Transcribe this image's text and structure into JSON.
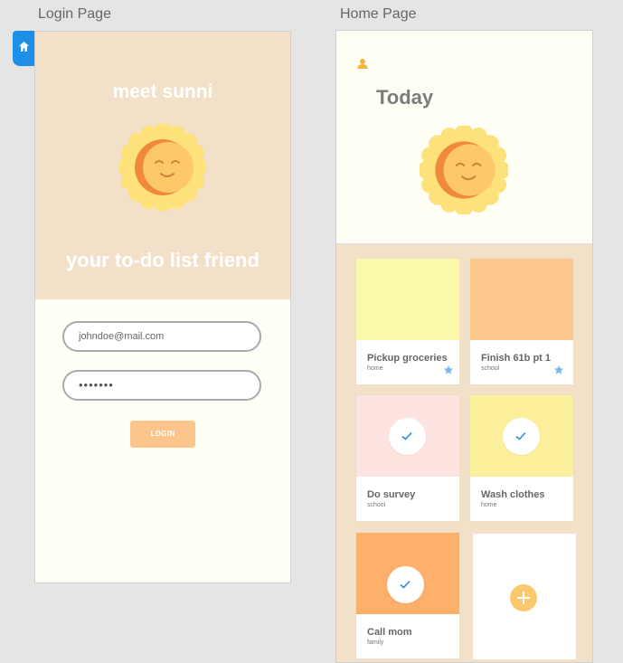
{
  "artboards": {
    "login_label": "Login Page",
    "home_label": "Home Page"
  },
  "login": {
    "brand_title": "meet sunni",
    "tagline": "your to-do list friend",
    "email_value": "johndoe@mail.com",
    "password_value": "•••••••",
    "button_label": "LOGIN",
    "colors": {
      "top_bg": "#f2e1c8",
      "bottom_bg": "#fffff5",
      "button": "#fbc58c"
    }
  },
  "home": {
    "title": "Today",
    "user_icon": "person-icon",
    "cards": [
      {
        "title": "Pickup groceries",
        "tag": "home",
        "color": "#fafaaa",
        "starred": true,
        "done": false
      },
      {
        "title": "Finish 61b pt 1",
        "tag": "school",
        "color": "#fdc88c",
        "starred": true,
        "done": false
      },
      {
        "title": "Do survey",
        "tag": "school",
        "color": "#fde4e0",
        "starred": false,
        "done": true
      },
      {
        "title": "Wash clothes",
        "tag": "home",
        "color": "#fdf09c",
        "starred": false,
        "done": true
      },
      {
        "title": "Call mom",
        "tag": "family",
        "color": "#fdb06a",
        "starred": false,
        "done": true
      }
    ],
    "add_icon": "plus-icon"
  },
  "sidebar": {
    "home_tab_icon": "home-icon"
  }
}
